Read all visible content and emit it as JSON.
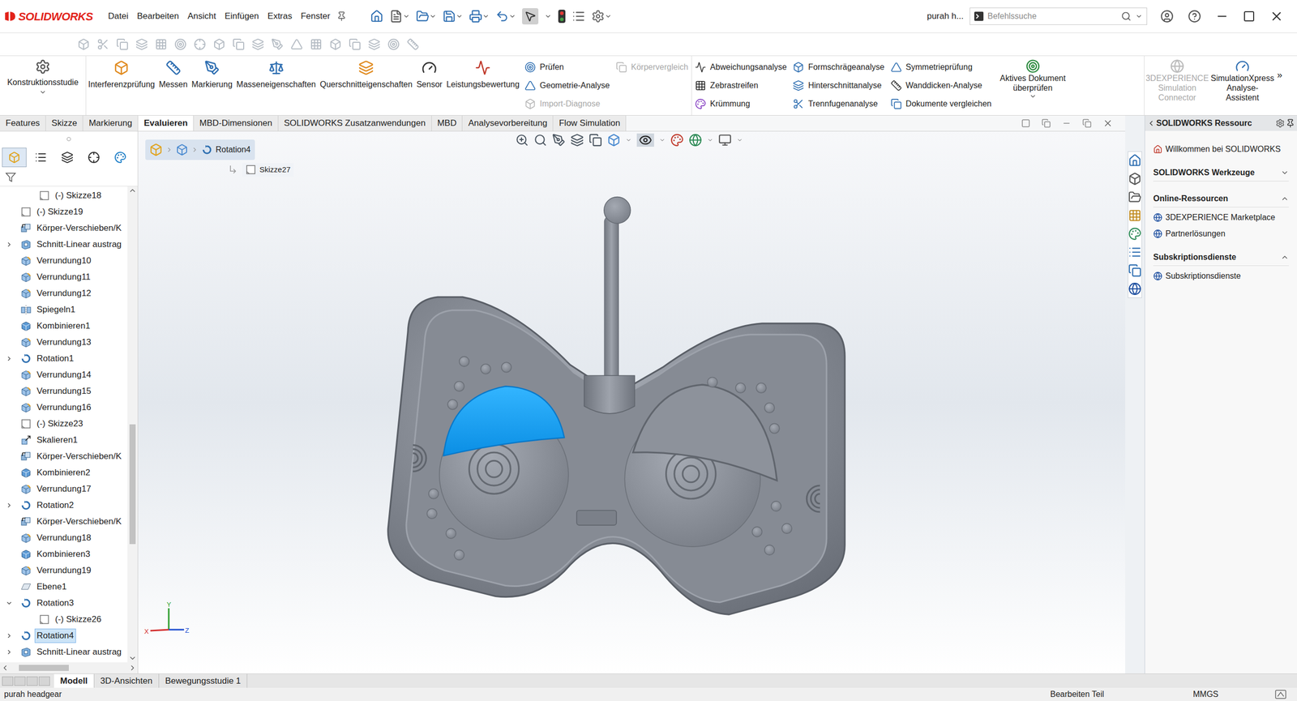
{
  "app": {
    "logo": "SOLIDWORKS",
    "menus": [
      "Datei",
      "Bearbeiten",
      "Ansicht",
      "Einfügen",
      "Extras",
      "Fenster"
    ],
    "user": "purah h...",
    "search_placeholder": "Befehlssuche"
  },
  "ribbon": {
    "first": {
      "label": "Konstruktionsstudie",
      "dropdown": true
    },
    "large": [
      {
        "label": "Interferenzprüfung"
      },
      {
        "label": "Messen"
      },
      {
        "label": "Markierung"
      },
      {
        "label": "Masseneigenschaften"
      },
      {
        "label": "Querschnitteigenschaften"
      },
      {
        "label": "Sensor"
      },
      {
        "label": "Leistungsbewertung"
      }
    ],
    "columns": [
      [
        {
          "label": "Prüfen",
          "disabled": false
        },
        {
          "label": "Geometrie-Analyse",
          "disabled": false
        },
        {
          "label": "Import-Diagnose",
          "disabled": true
        }
      ],
      [
        {
          "label": "Körpervergleich",
          "disabled": true
        }
      ],
      [
        {
          "label": "Abweichungsanalyse",
          "disabled": false
        },
        {
          "label": "Zebrastreifen",
          "disabled": false
        },
        {
          "label": "Krümmung",
          "disabled": false
        }
      ],
      [
        {
          "label": "Formschrägeanalyse",
          "disabled": false
        },
        {
          "label": "Hinterschnittanalyse",
          "disabled": false
        },
        {
          "label": "Trennfugenanalyse",
          "disabled": false
        }
      ],
      [
        {
          "label": "Symmetrieprüfung",
          "disabled": false
        },
        {
          "label": "Wanddicken-Analyse",
          "disabled": false
        },
        {
          "label": "Dokumente vergleichen",
          "disabled": false
        }
      ]
    ],
    "check": {
      "label": "Aktives Dokument überprüfen",
      "dropdown": true
    },
    "right": [
      {
        "label": "3DEXPERIENCE Simulation Connector",
        "disabled": true
      },
      {
        "label": "SimulationXpress Analyse-Assistent",
        "disabled": false
      }
    ],
    "more": "»"
  },
  "tabs": [
    {
      "label": "Features",
      "selected": false
    },
    {
      "label": "Skizze",
      "selected": false
    },
    {
      "label": "Markierung",
      "selected": false
    },
    {
      "label": "Evaluieren",
      "selected": true
    },
    {
      "label": "MBD-Dimensionen",
      "selected": false
    },
    {
      "label": "SOLIDWORKS Zusatzanwendungen",
      "selected": false
    },
    {
      "label": "MBD",
      "selected": false
    },
    {
      "label": "Analysevorbereitung",
      "selected": false
    },
    {
      "label": "Flow Simulation",
      "selected": false
    }
  ],
  "feature_tree": {
    "items": [
      {
        "name": "(-) Skizze18",
        "kind": "sketch",
        "level": 1,
        "expandable": false,
        "expanded": false,
        "selected": false
      },
      {
        "name": "(-) Skizze19",
        "kind": "sketch",
        "level": 0,
        "expandable": false,
        "expanded": false,
        "selected": false
      },
      {
        "name": "Körper-Verschieben/K",
        "kind": "move",
        "level": 0,
        "expandable": false,
        "expanded": false,
        "selected": false
      },
      {
        "name": "Schnitt-Linear austrag",
        "kind": "cut",
        "level": 0,
        "expandable": true,
        "expanded": false,
        "selected": false
      },
      {
        "name": "Verrundung10",
        "kind": "fillet",
        "level": 0,
        "expandable": false,
        "expanded": false,
        "selected": false
      },
      {
        "name": "Verrundung11",
        "kind": "fillet",
        "level": 0,
        "expandable": false,
        "expanded": false,
        "selected": false
      },
      {
        "name": "Verrundung12",
        "kind": "fillet",
        "level": 0,
        "expandable": false,
        "expanded": false,
        "selected": false
      },
      {
        "name": "Spiegeln1",
        "kind": "mirror",
        "level": 0,
        "expandable": false,
        "expanded": false,
        "selected": false
      },
      {
        "name": "Kombinieren1",
        "kind": "combine",
        "level": 0,
        "expandable": false,
        "expanded": false,
        "selected": false
      },
      {
        "name": "Verrundung13",
        "kind": "fillet",
        "level": 0,
        "expandable": false,
        "expanded": false,
        "selected": false
      },
      {
        "name": "Rotation1",
        "kind": "revolve",
        "level": 0,
        "expandable": true,
        "expanded": false,
        "selected": false
      },
      {
        "name": "Verrundung14",
        "kind": "fillet",
        "level": 0,
        "expandable": false,
        "expanded": false,
        "selected": false
      },
      {
        "name": "Verrundung15",
        "kind": "fillet",
        "level": 0,
        "expandable": false,
        "expanded": false,
        "selected": false
      },
      {
        "name": "Verrundung16",
        "kind": "fillet",
        "level": 0,
        "expandable": false,
        "expanded": false,
        "selected": false
      },
      {
        "name": "(-) Skizze23",
        "kind": "sketch",
        "level": 0,
        "expandable": false,
        "expanded": false,
        "selected": false
      },
      {
        "name": "Skalieren1",
        "kind": "scale",
        "level": 0,
        "expandable": false,
        "expanded": false,
        "selected": false
      },
      {
        "name": "Körper-Verschieben/K",
        "kind": "move",
        "level": 0,
        "expandable": false,
        "expanded": false,
        "selected": false
      },
      {
        "name": "Kombinieren2",
        "kind": "combine",
        "level": 0,
        "expandable": false,
        "expanded": false,
        "selected": false
      },
      {
        "name": "Verrundung17",
        "kind": "fillet",
        "level": 0,
        "expandable": false,
        "expanded": false,
        "selected": false
      },
      {
        "name": "Rotation2",
        "kind": "revolve",
        "level": 0,
        "expandable": true,
        "expanded": false,
        "selected": false
      },
      {
        "name": "Körper-Verschieben/K",
        "kind": "move",
        "level": 0,
        "expandable": false,
        "expanded": false,
        "selected": false
      },
      {
        "name": "Verrundung18",
        "kind": "fillet",
        "level": 0,
        "expandable": false,
        "expanded": false,
        "selected": false
      },
      {
        "name": "Kombinieren3",
        "kind": "combine",
        "level": 0,
        "expandable": false,
        "expanded": false,
        "selected": false
      },
      {
        "name": "Verrundung19",
        "kind": "fillet",
        "level": 0,
        "expandable": false,
        "expanded": false,
        "selected": false
      },
      {
        "name": "Ebene1",
        "kind": "plane",
        "level": 0,
        "expandable": false,
        "expanded": false,
        "selected": false
      },
      {
        "name": "Rotation3",
        "kind": "revolve",
        "level": 0,
        "expandable": true,
        "expanded": true,
        "selected": false
      },
      {
        "name": "(-) Skizze26",
        "kind": "sketch",
        "level": 1,
        "expandable": false,
        "expanded": false,
        "selected": false
      },
      {
        "name": "Rotation4",
        "kind": "revolve",
        "level": 0,
        "expandable": true,
        "expanded": false,
        "selected": true
      },
      {
        "name": "Schnitt-Linear austrag",
        "kind": "cut",
        "level": 0,
        "expandable": true,
        "expanded": false,
        "selected": false
      }
    ],
    "vscroll": {
      "offset": 0.5,
      "size": 0.26
    },
    "hscroll": {
      "offset": 0.08,
      "size": 0.42
    }
  },
  "breadcrumb": {
    "feature": "Rotation4",
    "sketch": "Skizze27"
  },
  "triad": {
    "x": "X",
    "y": "Y",
    "z": "Z"
  },
  "task_pane": {
    "title": "SOLIDWORKS Ressourc",
    "welcome": "Willkommen bei SOLIDWORKS",
    "sections": [
      {
        "title": "SOLIDWORKS Werkzeuge",
        "expanded": false,
        "items": []
      },
      {
        "title": "Online-Ressourcen",
        "expanded": true,
        "items": [
          "3DEXPERIENCE Marketplace",
          "Partnerlösungen"
        ]
      },
      {
        "title": "Subskriptionsdienste",
        "expanded": true,
        "items": [
          "Subskriptionsdienste"
        ]
      }
    ]
  },
  "bottom_tabs": [
    {
      "label": "Modell",
      "selected": true
    },
    {
      "label": "3D-Ansichten",
      "selected": false
    },
    {
      "label": "Bewegungsstudie 1",
      "selected": false
    }
  ],
  "status_bar": {
    "document": "purah headgear",
    "mode": "Bearbeiten Teil",
    "units": "MMGS"
  }
}
